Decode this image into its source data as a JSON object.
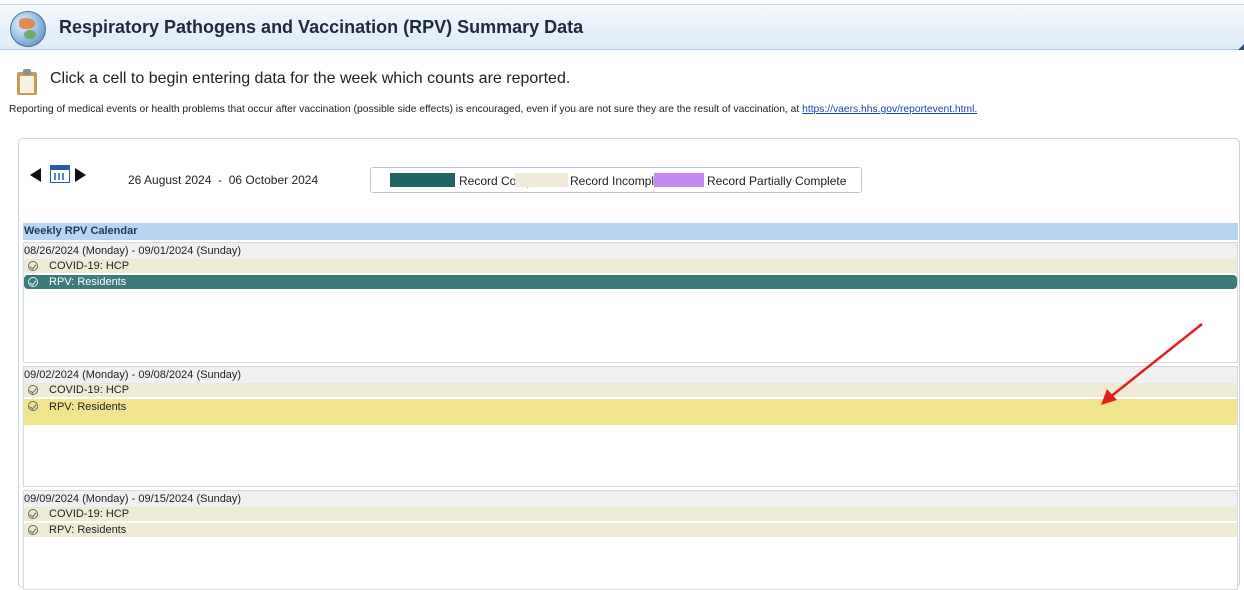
{
  "header": {
    "title": "Respiratory Pathogens and Vaccination (RPV) Summary Data"
  },
  "instruction": "Click a cell to begin entering data for the week which counts are reported.",
  "notice": {
    "text": "Reporting of medical events or health problems that occur after vaccination (possible side effects) is encouraged, even if you are not sure they are the result of vaccination, at ",
    "link": "https://vaers.hhs.gov/reportevent.html."
  },
  "nav": {
    "date_range": "26 August 2024  -  06 October 2024"
  },
  "legend": {
    "items": [
      {
        "label": "Record Complete",
        "color": "#1e6465"
      },
      {
        "label": "Record Incomplete",
        "color": "#f0ebd8"
      },
      {
        "label": "Record Partially Complete",
        "color": "#c589f0"
      }
    ]
  },
  "calendar": {
    "header": "Weekly RPV Calendar",
    "weeks": [
      {
        "range": "08/26/2024 (Monday) - 09/01/2024 (Sunday)",
        "records": [
          {
            "label": "COVID-19: HCP",
            "status": "incomplete"
          },
          {
            "label": "RPV: Residents",
            "status": "complete"
          }
        ]
      },
      {
        "range": "09/02/2024 (Monday) - 09/08/2024 (Sunday)",
        "records": [
          {
            "label": "COVID-19: HCP",
            "status": "incomplete"
          },
          {
            "label": "RPV: Residents",
            "status": "incomplete-highlighted"
          }
        ]
      },
      {
        "range": "09/09/2024 (Monday) - 09/15/2024 (Sunday)",
        "records": [
          {
            "label": "COVID-19: HCP",
            "status": "incomplete"
          },
          {
            "label": "RPV: Residents",
            "status": "incomplete"
          }
        ]
      }
    ]
  },
  "colors": {
    "complete": "#3c7a7b",
    "incomplete": "#eeebd5",
    "highlight": "#f2e38e",
    "annotation_arrow": "#e0201c"
  }
}
